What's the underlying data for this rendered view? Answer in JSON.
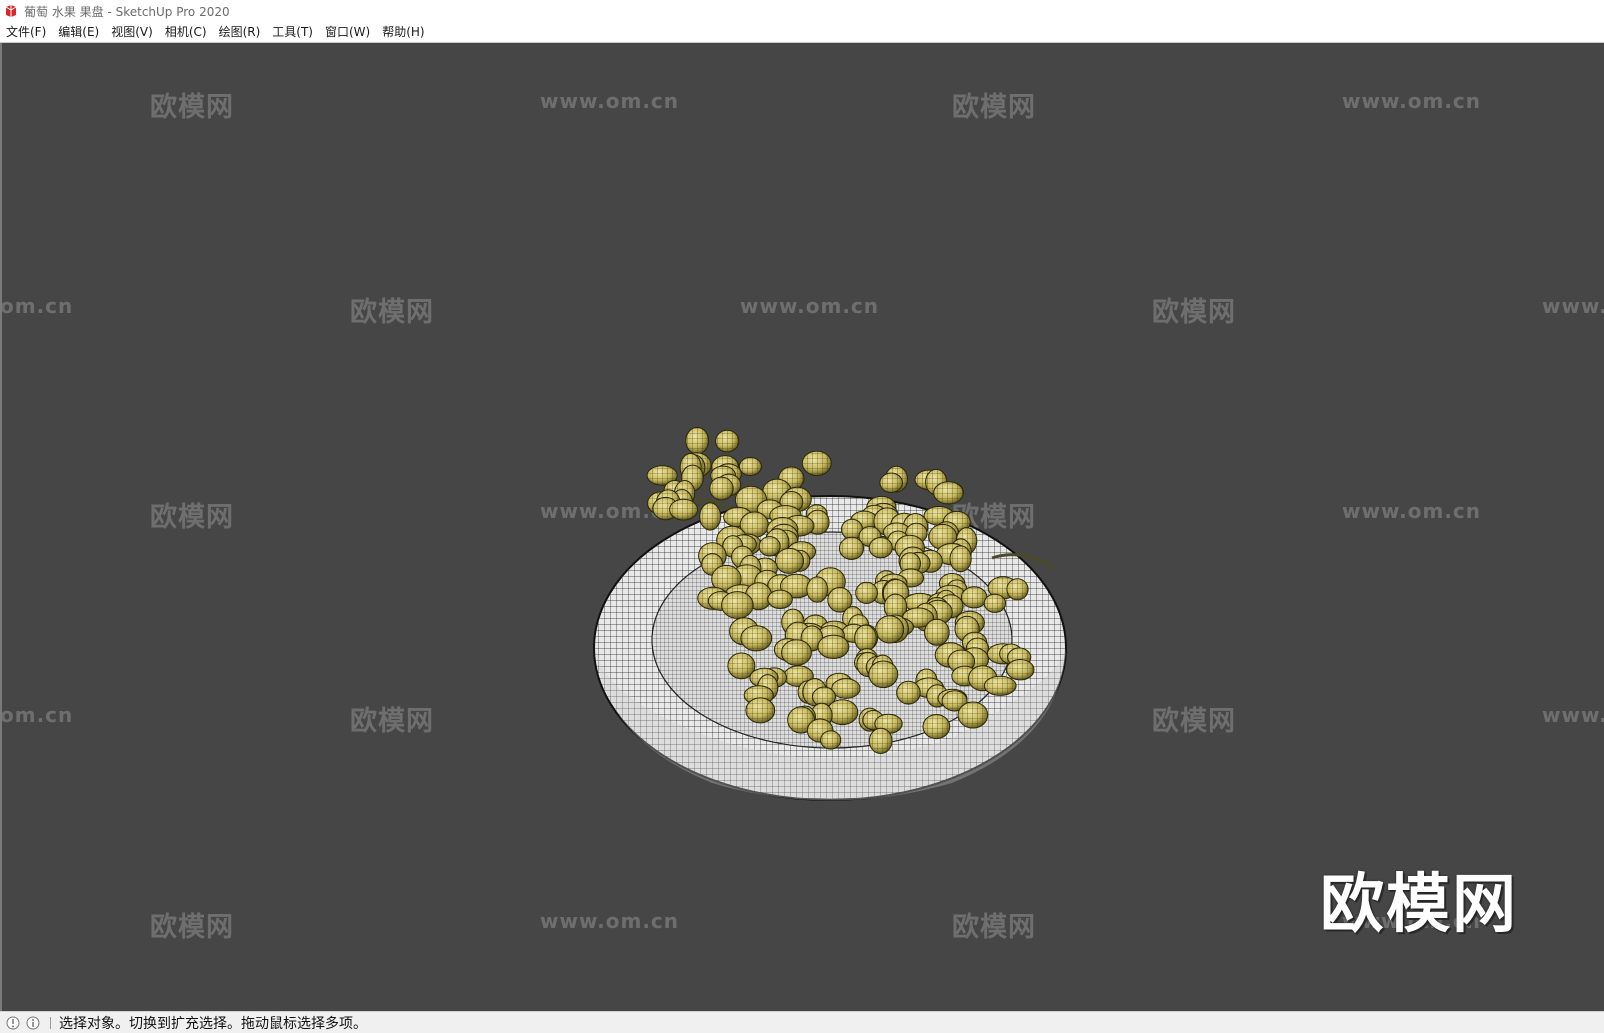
{
  "window": {
    "title": "葡萄 水果 果盘 - SketchUp Pro 2020",
    "icon": "sketchup-app-icon"
  },
  "menubar": {
    "items": [
      {
        "label": "文件(F)"
      },
      {
        "label": "编辑(E)"
      },
      {
        "label": "视图(V)"
      },
      {
        "label": "相机(C)"
      },
      {
        "label": "绘图(R)"
      },
      {
        "label": "工具(T)"
      },
      {
        "label": "窗口(W)"
      },
      {
        "label": "帮助(H)"
      }
    ]
  },
  "viewport": {
    "background": "#464646",
    "watermark_cn": "欧模网",
    "watermark_url": "www.om.cn",
    "watermark_url_partial_right": "www.",
    "watermark_url_partial_left": "om.cn",
    "brand_logo": "欧模网"
  },
  "statusbar": {
    "icons": [
      "geo-location-icon",
      "info-icon"
    ],
    "message": "选择对象。切换到扩充选择。拖动鼠标选择多项。"
  }
}
